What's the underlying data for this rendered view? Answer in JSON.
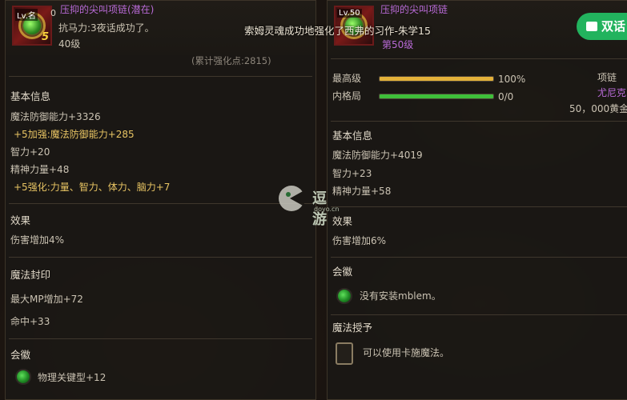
{
  "left": {
    "item_name": "压抑的尖叫项链(潜在)",
    "level_badge": "Lv.名",
    "count_badge": "0",
    "plus_badge": "5",
    "option_line": "抗马力:3夜话成功了。",
    "level_text": "40级",
    "cumulative": "(累计强化点:2815)",
    "basic_title": "基本信息",
    "stats": [
      {
        "text": "魔法防御能力+3326",
        "style": "stat"
      },
      {
        "text": "+5加强:魔法防御能力+285",
        "style": "gold"
      },
      {
        "text": "智力+20",
        "style": "stat"
      },
      {
        "text": "精神力量+48",
        "style": "stat"
      },
      {
        "text": "+5强化:力量、智力、体力、脑力+7",
        "style": "gold"
      }
    ],
    "effect_title": "效果",
    "effect_text": "伤害增加4%",
    "seal_title": "魔法封印",
    "seal_lines": [
      "最大MP增加+72",
      "命中+33"
    ],
    "emblem_title": "会徽",
    "emblem_text": "物理关键型+12"
  },
  "right": {
    "level_badge": "Lv.50",
    "item_name": "压抑的尖叫项链",
    "level_text": "第50级",
    "max_level_label": "最高级",
    "max_level_value": "100%",
    "inner_label": "内格局",
    "inner_value": "0/0",
    "inner_fill": 1.0,
    "max_fill": 1.0,
    "type_label": "项链",
    "seller": "尤尼克",
    "price": "50，000黄金",
    "basic_title": "基本信息",
    "stats": [
      "魔法防御能力+4019",
      "智力+23",
      "精神力量+58"
    ],
    "effect_title": "效果",
    "effect_text": "伤害增加6%",
    "emblem_title": "会徽",
    "emblem_text": "没有安装mblem。",
    "grant_title": "魔法授予",
    "grant_text": "可以使用卡施魔法。"
  },
  "notice": "索姆灵魂成功地强化了西弗的习作-朱学15",
  "share_label": "双话",
  "watermark": {
    "name": "逗游",
    "domain": "doyo.cn"
  },
  "colors": {
    "bar_gold": "#e3b13a",
    "bar_green": "#3fbf3a",
    "share_green": "#22b35e",
    "gold_text": "#e8c463",
    "purple_text": "#b86ad6"
  }
}
